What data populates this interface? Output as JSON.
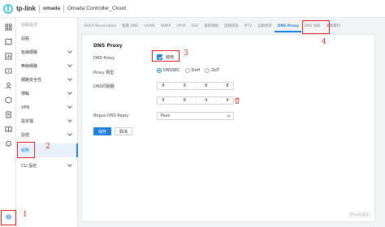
{
  "header": {
    "brand": "tp-link",
    "product": "omada",
    "title": "Omada Controller_Cloud"
  },
  "rail": {
    "icons": [
      "grid-icon",
      "map-icon",
      "chart-icon",
      "device-icon",
      "users-icon",
      "shield-icon",
      "report-icon",
      "book-icon",
      "bell-icon",
      "gear-icon"
    ]
  },
  "sidenav": {
    "group_title": "站點設定",
    "items": [
      {
        "label": "站點",
        "has_chevron": false
      },
      {
        "label": "有線網路",
        "has_chevron": true
      },
      {
        "label": "無線網路",
        "has_chevron": true
      },
      {
        "label": "網路安全性",
        "has_chevron": true
      },
      {
        "label": "傳輸",
        "has_chevron": true
      },
      {
        "label": "VPN",
        "has_chevron": true
      },
      {
        "label": "設定檔",
        "has_chevron": true
      },
      {
        "label": "認證",
        "has_chevron": true
      },
      {
        "label": "服務",
        "has_chevron": false,
        "active": true
      },
      {
        "label": "CLI 設定",
        "has_chevron": true
      }
    ]
  },
  "tabs": [
    "DHCP Reservation",
    "動態 DNS",
    "mDNS",
    "SNMP",
    "UPnP",
    "SSH",
    "重新啟動",
    "連線排程",
    "IPTV",
    "自動更新",
    "DNS Proxy",
    "DNS 快取",
    "遠端資料"
  ],
  "active_tab": "DNS Proxy",
  "form": {
    "section_title": "DNS Proxy",
    "dns_proxy_label": "DNS Proxy",
    "enable_label": "啟用",
    "proxy_type_label": "Proxy 類型",
    "proxy_types": [
      "DNSSEC",
      "DoH",
      "DoT"
    ],
    "proxy_type_selected": "DNSSEC",
    "dns_server_label": "DNS伺服器",
    "dns_servers": [
      [
        "8",
        "8",
        "8",
        "8"
      ],
      [
        "8",
        "8",
        "4",
        "4"
      ]
    ],
    "bogus_label": "Bogus DNS Reply",
    "bogus_value": "Pass",
    "apply_label": "儲存",
    "cancel_label": "取消"
  },
  "watermark": "Omada版本",
  "annotations": [
    "1",
    "2",
    "3",
    "4"
  ],
  "colors": {
    "accent": "#1f7fe0",
    "annotation": "#e02020",
    "brand": "#4acbd6"
  }
}
